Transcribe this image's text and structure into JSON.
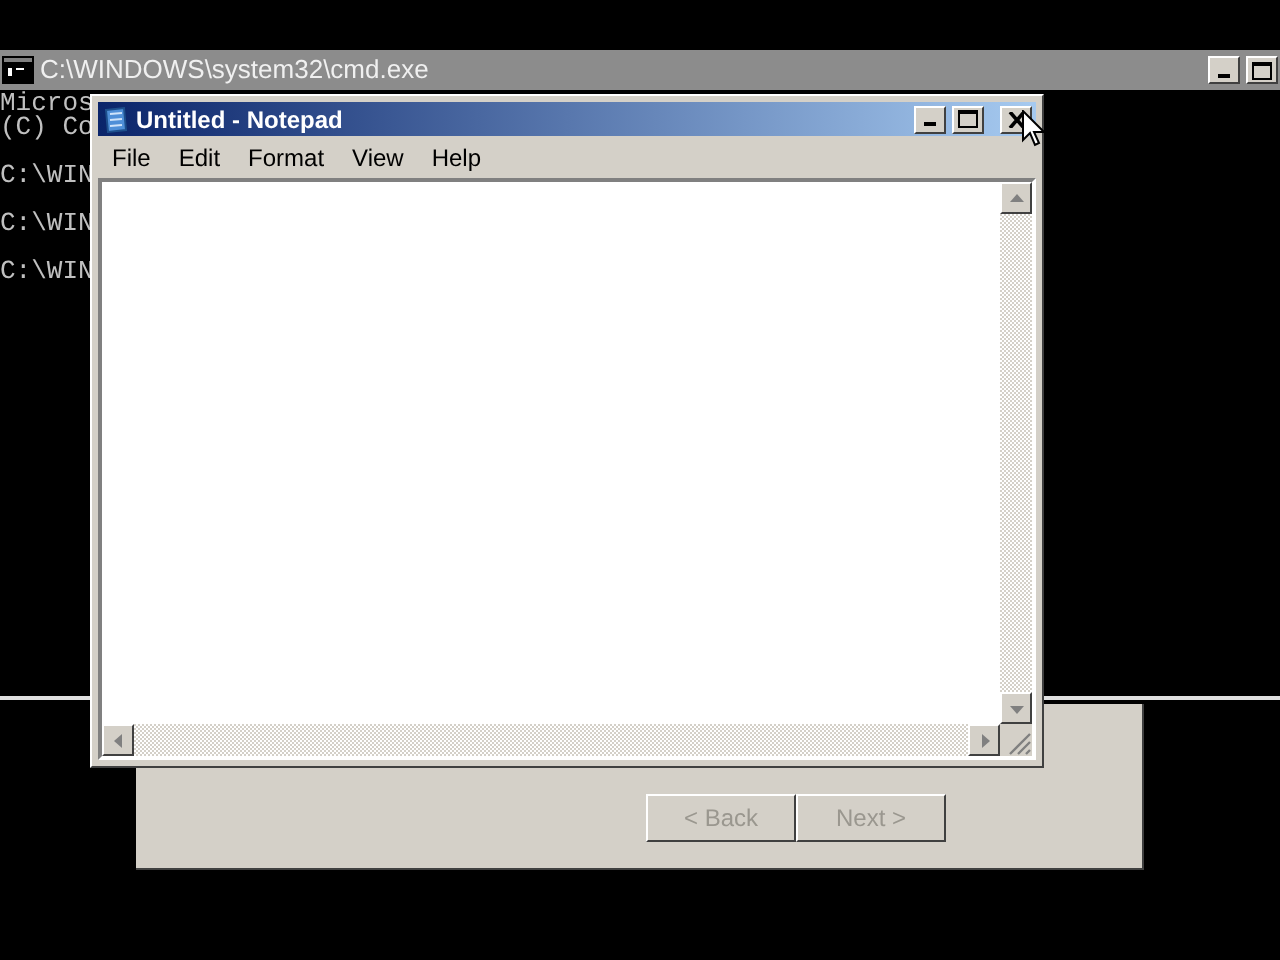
{
  "console": {
    "title": "C:\\WINDOWS\\system32\\cmd.exe",
    "active": false,
    "blocks": [
      {
        "lines": [
          "Micros",
          "(C) Co"
        ]
      },
      {
        "lines": [
          "C:\\WIN"
        ]
      },
      {
        "lines": [
          "C:\\WIN"
        ]
      },
      {
        "lines": [
          "C:\\WIN"
        ]
      }
    ]
  },
  "wizard": {
    "buttons": [
      {
        "label": "< Back",
        "disabled": true
      },
      {
        "label": "Next >",
        "disabled": true
      }
    ]
  },
  "notepad": {
    "title": "Untitled - Notepad",
    "active": true,
    "menu": [
      {
        "label": "File"
      },
      {
        "label": "Edit"
      },
      {
        "label": "Format"
      },
      {
        "label": "View"
      },
      {
        "label": "Help"
      }
    ]
  }
}
